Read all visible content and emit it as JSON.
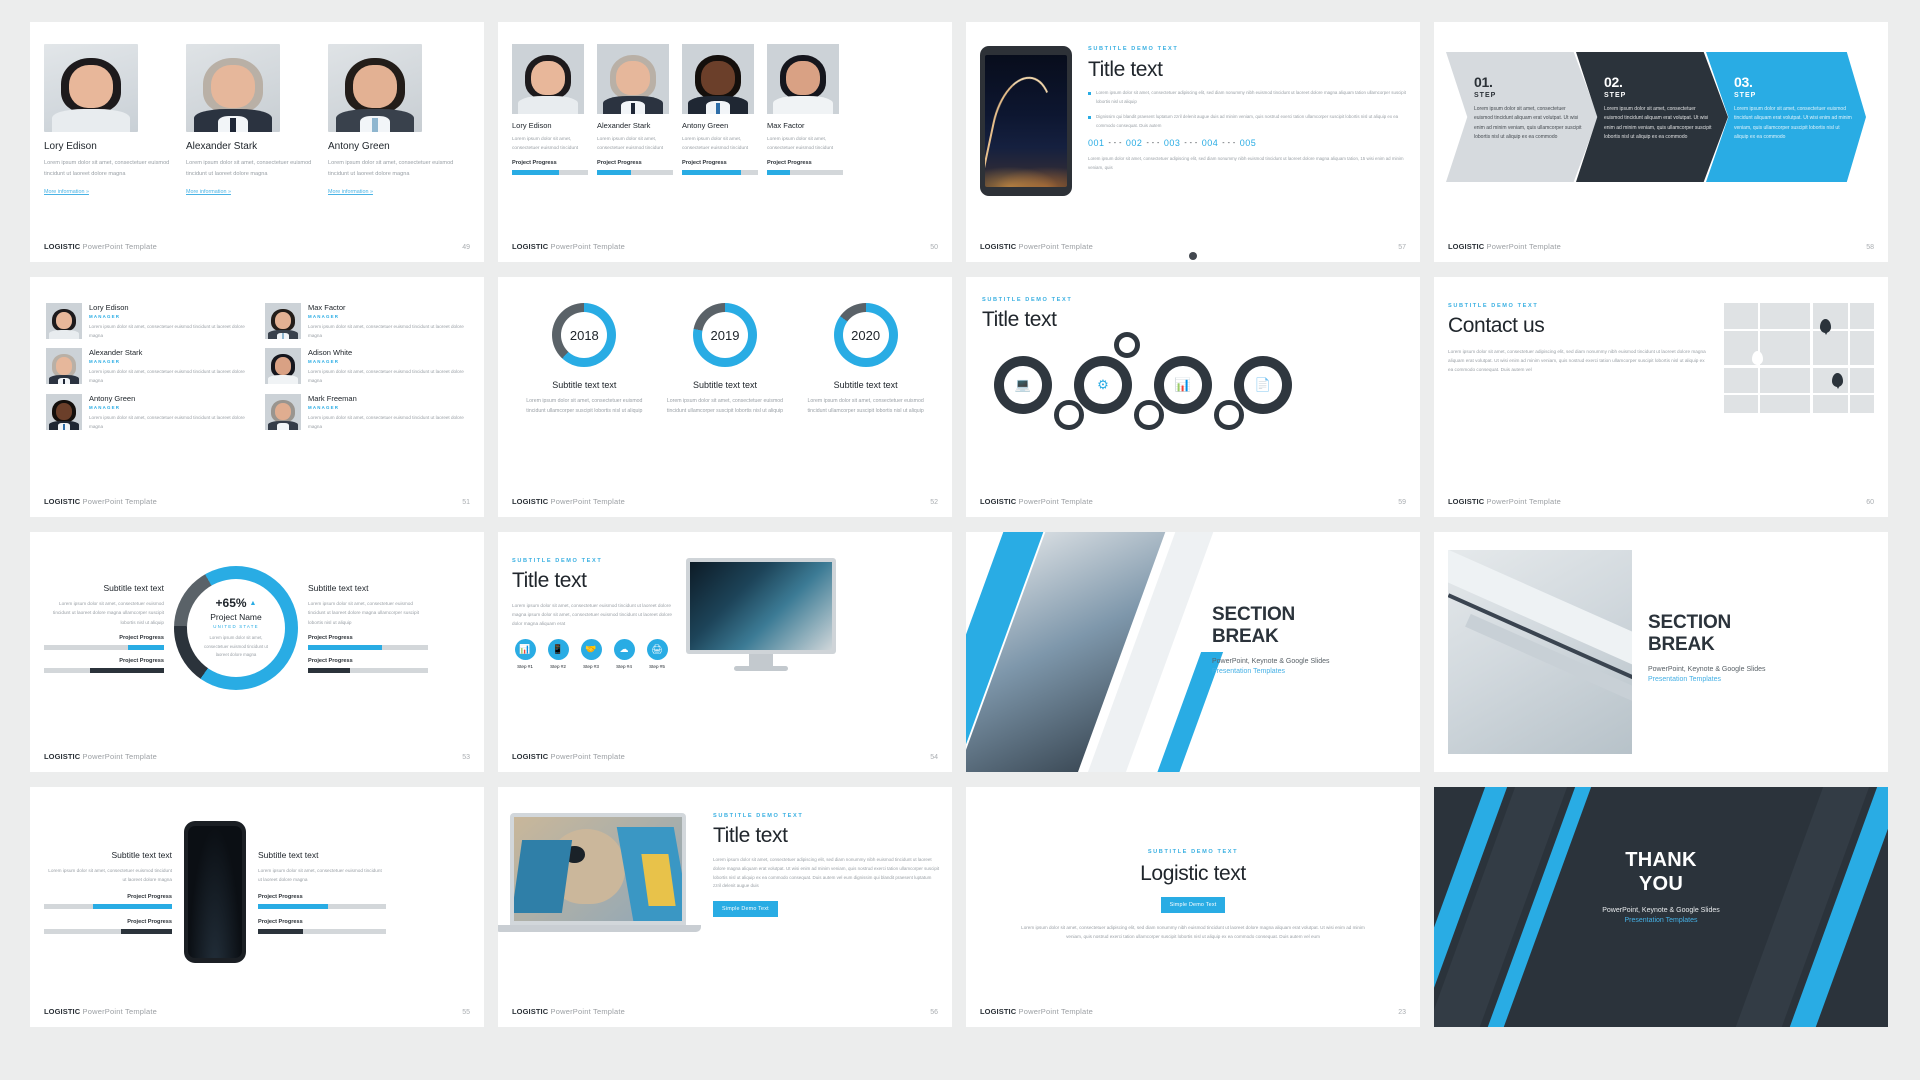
{
  "brand": {
    "accent": "#29ace4",
    "dark": "#2b333b",
    "grey": "#d6dade"
  },
  "footer": {
    "bold": "LOGISTIC",
    "rest": " PowerPoint Template"
  },
  "common": {
    "subtitle_demo": "SUBTITLE DEMO TEXT",
    "title_text": "Title text",
    "subtitle_text_text": "Subtitle text text",
    "project_progress": "Project Progress",
    "more_information": "More information »",
    "lorem_short": "Lorem ipsum dolor sit amet, consectetuer euismod tincidunt ut laoreet dolore magna",
    "lorem_mid": "Lorem ipsum dolor sit amet, consectetuer euismod tincidunt",
    "lorem_long": "Lorem ipsum dolor sit amet, consectetuer euismod tincidunt ut laoreet dolore magna ullamcorper suscipit lobortis nisl ut aliquip",
    "manager": "MANAGER"
  },
  "slides": [
    {
      "page": "49",
      "people": [
        {
          "name": "Lory Edison",
          "desc": "Lorem ipsum dolor sit amet, consectetuer euismod tincidunt ut laoreet dolore magna",
          "link": "More information »"
        },
        {
          "name": "Alexander Stark",
          "desc": "Lorem ipsum dolor sit amet, consectetuer euismod tincidunt ut laoreet dolore magna",
          "link": "More information »"
        },
        {
          "name": "Antony Green",
          "desc": "Lorem ipsum dolor sit amet, consectetuer euismod tincidunt ut laoreet dolore magna",
          "link": "More information »"
        }
      ]
    },
    {
      "page": "50",
      "people": [
        {
          "name": "Lory Edison",
          "desc": "Lorem ipsum dolor sit amet, consectetuer euismod tincidunt",
          "progress_label": "Project Progress",
          "progress": 62
        },
        {
          "name": "Alexander Stark",
          "desc": "Lorem ipsum dolor sit amet, consectetuer euismod tincidunt",
          "progress_label": "Project Progress",
          "progress": 45
        },
        {
          "name": "Antony Green",
          "desc": "Lorem ipsum dolor sit amet, consectetuer euismod tincidunt",
          "progress_label": "Project Progress",
          "progress": 78
        },
        {
          "name": "Max Factor",
          "desc": "Lorem ipsum dolor sit amet, consectetuer euismod tincidunt",
          "progress_label": "Project Progress",
          "progress": 30
        }
      ]
    },
    {
      "page": "57",
      "subtitle": "SUBTITLE DEMO TEXT",
      "title": "Title text",
      "bullets": [
        "Lorem ipsum dolor sit amet, consectetuer adipiscing elit, sed diam nonummy nibh euismod tincidunt ut laoreet dolore magna aliquam tation ullamcorper suscipit lobortis nisl ut aliquip",
        "Dignissim qui blandit praesent luptatum zzril delenit augue duis ad minim veniam, quis nostrud exerci tation ullamcorper suscipit lobortis nisl ut aliquip ex ea commodo consequat. Duis autem"
      ],
      "numbers": [
        "001",
        "002",
        "003",
        "004",
        "005"
      ],
      "caption": "Lorem ipsum dolor sit amet, consectetuer adipiscing elit, sed diam nonummy nibh euismod tincidunt ut laoreet dolore magna aliquam tation, 15 wisi enim ad minim veniam, quis"
    },
    {
      "page": "58",
      "steps": [
        {
          "num": "01.",
          "label": "STEP",
          "text": "Lorem ipsum dolor sit amet, consectetuer euismod tincidunt aliquam erat volutpat. Ut wisi enim ad minim veniam, quis ullamcorper suscipit lobortis nisl ut aliquip ex ea commodo"
        },
        {
          "num": "02.",
          "label": "STEP",
          "text": "Lorem ipsum dolor sit amet, consectetuer euismod tincidunt aliquam erat volutpat. Ut wisi enim ad minim veniam, quis ullamcorper suscipit lobortis nisl ut aliquip ex ea commodo"
        },
        {
          "num": "03.",
          "label": "STEP",
          "text": "Lorem ipsum dolor sit amet, consectetuer euismod tincidunt aliquam erat volutpat. Ut wisi enim ad minim veniam, quis ullamcorper suscipit lobortis nisl ut aliquip ex ea commodo"
        }
      ]
    },
    {
      "page": "51",
      "team": [
        {
          "name": "Lory Edison",
          "role": "MANAGER",
          "desc": "Lorem ipsum dolor sit amet, consectetuer euismod tincidunt ut laoreet dolore magna"
        },
        {
          "name": "Max Factor",
          "role": "MANAGER",
          "desc": "Lorem ipsum dolor sit amet, consectetuer euismod tincidunt ut laoreet dolore magna"
        },
        {
          "name": "Alexander Stark",
          "role": "MANAGER",
          "desc": "Lorem ipsum dolor sit amet, consectetuer euismod tincidunt ut laoreet dolore magna"
        },
        {
          "name": "Adison White",
          "role": "MANAGER",
          "desc": "Lorem ipsum dolor sit amet, consectetuer euismod tincidunt ut laoreet dolore magna"
        },
        {
          "name": "Antony Green",
          "role": "MANAGER",
          "desc": "Lorem ipsum dolor sit amet, consectetuer euismod tincidunt ut laoreet dolore magna"
        },
        {
          "name": "Mark Freeman",
          "role": "MANAGER",
          "desc": "Lorem ipsum dolor sit amet, consectetuer euismod tincidunt ut laoreet dolore magna"
        }
      ]
    },
    {
      "page": "52",
      "donuts": [
        {
          "year": "2018",
          "subtitle": "Subtitle text text",
          "pct": 62,
          "desc": "Lorem ipsum dolor sit amet, consectetuer euismod tincidunt ullamcorper suscipit lobortis nisl ut aliquip"
        },
        {
          "year": "2019",
          "subtitle": "Subtitle text text",
          "pct": 78,
          "desc": "Lorem ipsum dolor sit amet, consectetuer euismod tincidunt ullamcorper suscipit lobortis nisl ut aliquip"
        },
        {
          "year": "2020",
          "subtitle": "Subtitle text text",
          "pct": 85,
          "desc": "Lorem ipsum dolor sit amet, consectetuer euismod tincidunt ullamcorper suscipit lobortis nisl ut aliquip"
        }
      ]
    },
    {
      "page": "59",
      "subtitle": "SUBTITLE DEMO TEXT",
      "title": "Title text"
    },
    {
      "page": "60",
      "subtitle": "SUBTITLE DEMO TEXT",
      "title": "Contact us",
      "desc": "Lorem ipsum dolor sit amet, consectetuer adipiscing elit, sed diam nonummy nibh euismod tincidunt ut laoreet dolore magna aliquam erat volutpat. Ut wisi enim ad minim veniam, quis nostrud exerci tation ullamcorper suscipit lobortis nisl ut aliquip ex ea commodo consequat. Duis autem vel"
    },
    {
      "page": "53",
      "center": {
        "pct": "+65%",
        "name": "Project Name",
        "country": "UNITED STATE",
        "desc": "Lorem ipsum dolor sit amet, consectetuer euismod tincidunt ut laoreet dolore magna"
      },
      "left": {
        "subtitle": "Subtitle text text",
        "desc": "Lorem ipsum dolor sit amet, consectetuer euismod tincidunt ut laoreet dolore magna ullamcorper suscipit lobortis nisl ut aliquip",
        "bars": [
          {
            "label": "Project Progress",
            "pct": 30
          },
          {
            "label": "Project Progress",
            "pct": 62
          }
        ]
      },
      "right": {
        "subtitle": "Subtitle text text",
        "desc": "Lorem ipsum dolor sit amet, consectetuer euismod tincidunt ut laoreet dolore magna ullamcorper suscipit lobortis nisl ut aliquip",
        "bars": [
          {
            "label": "Project Progress",
            "pct": 62
          },
          {
            "label": "Project Progress",
            "pct": 35
          }
        ]
      }
    },
    {
      "page": "54",
      "subtitle": "SUBTITLE DEMO TEXT",
      "title": "Title text",
      "desc": "Lorem ipsum dolor sit amet, consectetuer euismod tincidunt ut laoreet dolore magna ipsum dolor sit amet, consectetuer euismod tincidunt ut laoreet dolore dolor magna aliquam erat",
      "steps": [
        {
          "label": "Step #1",
          "icon": "presentation-icon"
        },
        {
          "label": "Step #2",
          "icon": "mobile-icon"
        },
        {
          "label": "Step #3",
          "icon": "handshake-icon"
        },
        {
          "label": "Step #4",
          "icon": "cloud-icon"
        },
        {
          "label": "Step #5",
          "icon": "printer-icon"
        }
      ]
    },
    {
      "page": "",
      "title_line1": "SECTION",
      "title_line2": "BREAK",
      "sub": "PowerPoint, Keynote & Google Slides",
      "accent": "Presentation Templates"
    },
    {
      "page": "",
      "title_line1": "SECTION",
      "title_line2": "BREAK",
      "sub": "PowerPoint, Keynote & Google Slides",
      "accent": "Presentation Templates"
    },
    {
      "page": "55",
      "left": {
        "subtitle": "Subtitle text text",
        "desc": "Lorem ipsum dolor sit amet, consectetuer euismod tincidunt ut laoreet dolore magna",
        "bars": [
          {
            "label": "Project Progress",
            "pct": 62
          },
          {
            "label": "Project Progress",
            "pct": 40
          }
        ]
      },
      "right": {
        "subtitle": "Subtitle text text",
        "desc": "Lorem ipsum dolor sit amet, consectetuer euismod tincidunt ut laoreet dolore magna",
        "bars": [
          {
            "label": "Project Progress",
            "pct": 55
          },
          {
            "label": "Project Progress",
            "pct": 35
          }
        ]
      }
    },
    {
      "page": "56",
      "subtitle": "SUBTITLE DEMO TEXT",
      "title": "Title text",
      "desc": "Lorem ipsum dolor sit amet, consectetuer adipiscing elit, sed diam nonummy nibh euismod tincidunt ut laoreet dolore magna aliquam erat volutpat. Ut wisi enim ad minim veniam, quis nostrud exerci tation ullamcorper suscipit lobortis nisl ut aliquip ex ea commodo consequat. Duis autem vel eum dignissim qui blandit praesent luptatum zzril delenit augue duis",
      "button": "Simple Demo Text"
    },
    {
      "page": "23",
      "subtitle": "SUBTITLE DEMO TEXT",
      "title": "Logistic text",
      "button": "Simple Demo Text",
      "desc": "Lorem ipsum dolor sit amet, consectetuer adipiscing elit, sed diam nonummy nibh euismod tincidunt ut laoreet dolore magna aliquam erat volutpat. Ut wisi enim ad minim veniam, quis nostrud exerci tation ullamcorper suscipit lobortis nisl ut aliquip ex ea commodo consequat. Duis autem vel eum"
    },
    {
      "page": "",
      "title_line1": "THANK",
      "title_line2": "YOU",
      "sub": "PowerPoint, Keynote & Google Slides",
      "accent": "Presentation Templates"
    }
  ]
}
